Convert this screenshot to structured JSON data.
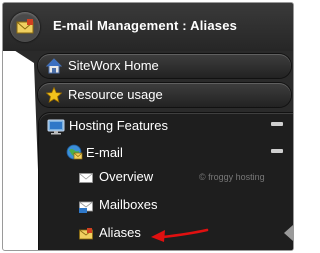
{
  "header": {
    "title": "E-mail Management : Aliases",
    "icon": "envelope-icon"
  },
  "nav": {
    "siteworx_home": {
      "label": "SiteWorx Home",
      "icon": "home-icon"
    },
    "resource_usage": {
      "label": "Resource usage",
      "icon": "star-icon"
    }
  },
  "hosting": {
    "label": "Hosting Features",
    "icon": "monitor-icon",
    "email": {
      "label": "E-mail",
      "icon": "globe-mail-icon",
      "items": [
        {
          "label": "Overview",
          "icon": "envelope-icon"
        },
        {
          "label": "Mailboxes",
          "icon": "mailbox-icon"
        },
        {
          "label": "Aliases",
          "icon": "alias-envelope-icon",
          "active": true
        }
      ]
    }
  },
  "watermark": "© froggy hosting",
  "colors": {
    "arrow": "#e01010",
    "panel": "#2a2a2a",
    "text": "#ffffff"
  }
}
